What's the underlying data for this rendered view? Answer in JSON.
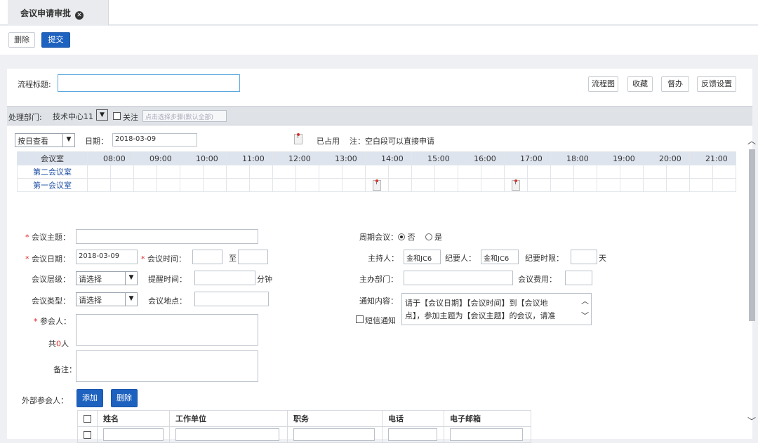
{
  "tab": {
    "title": "会议申请审批"
  },
  "toolbar": {
    "delete_label": "删除",
    "submit_label": "提交"
  },
  "header": {
    "flow_title_label": "流程标题:",
    "flow_title_value": "",
    "buttons": [
      "流程图",
      "收藏",
      "督办",
      "反馈设置"
    ]
  },
  "filter": {
    "dept_label": "处理部门:",
    "dept_value": "技术中心11",
    "follow_label": "关注",
    "step_placeholder": "点击选择步骤(默认全部)"
  },
  "schedule": {
    "view_mode": "按日查看",
    "date_label": "日期：",
    "date_value": "2018-03-09",
    "occupied_label": "已占用",
    "note": "注：空白段可以直接申请",
    "room_header": "会议室",
    "hours": [
      "08:00",
      "09:00",
      "10:00",
      "11:00",
      "12:00",
      "13:00",
      "14:00",
      "15:00",
      "16:00",
      "17:00",
      "18:00",
      "19:00",
      "20:00",
      "21:00"
    ],
    "rooms": [
      "第二会议室",
      "第一会议室"
    ],
    "bookings": [
      {
        "room": "第一会议室",
        "time": "14:00"
      },
      {
        "room": "第一会议室",
        "time": "17:00"
      }
    ]
  },
  "form": {
    "subject_label": "会议主题：",
    "date_label": "会议日期：",
    "date_value": "2018-03-09",
    "time_label": "会议时间：",
    "to_label": "至",
    "level_label": "会议层级：",
    "level_value": "请选择",
    "remind_label": "提醒时间：",
    "minutes_unit": "分钟",
    "type_label": "会议类型：",
    "type_value": "请选择",
    "location_label": "会议地点：",
    "attendees_label": "参会人：",
    "count_prefix": "共",
    "count_value": "0",
    "count_suffix": "人",
    "remark_label": "备注：",
    "periodic_label": "周期会议：",
    "periodic_no": "否",
    "periodic_yes": "是",
    "host_label": "主持人：",
    "host_value": "金和JC6",
    "recorder_label": "纪要人：",
    "recorder_value": "金和JC6",
    "deadline_label": "纪要时限：",
    "days_unit": "天",
    "dept_label": "主办部门：",
    "fee_label": "会议费用：",
    "notice_label": "通知内容：",
    "notice_line1": "请于【会议日期】【会议时间】到【会议地",
    "notice_line2": "点】，参加主题为【会议主题】的会议，请准",
    "sms_label": "短信通知"
  },
  "external": {
    "label": "外部参会人：",
    "add_label": "添加",
    "delete_label": "删除",
    "columns": [
      "姓名",
      "工作单位",
      "职务",
      "电话",
      "电子邮箱"
    ]
  }
}
